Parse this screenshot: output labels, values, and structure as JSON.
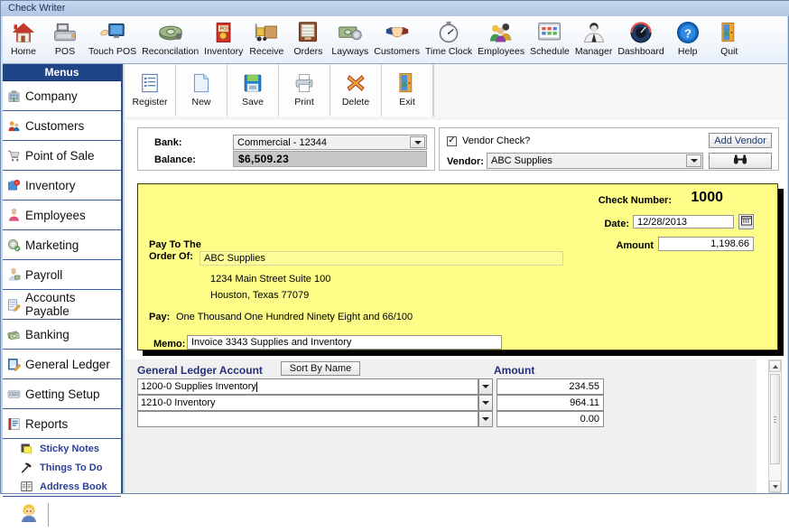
{
  "window": {
    "title": "Check Writer"
  },
  "toolbar": {
    "items": [
      {
        "label": "Home",
        "icon": "home-icon"
      },
      {
        "label": "POS",
        "icon": "cash-register-icon"
      },
      {
        "label": "Touch POS",
        "icon": "touch-screen-icon"
      },
      {
        "label": "Reconcilation",
        "icon": "money-icon"
      },
      {
        "label": "Inventory",
        "icon": "inventory-box-icon"
      },
      {
        "label": "Receive",
        "icon": "forklift-icon"
      },
      {
        "label": "Orders",
        "icon": "orders-cabinet-icon"
      },
      {
        "label": "Layways",
        "icon": "layaway-money-icon"
      },
      {
        "label": "Customers",
        "icon": "handshake-icon"
      },
      {
        "label": "Time Clock",
        "icon": "stopwatch-icon"
      },
      {
        "label": "Employees",
        "icon": "people-icon"
      },
      {
        "label": "Schedule",
        "icon": "calendar-icon"
      },
      {
        "label": "Manager",
        "icon": "manager-person-icon"
      },
      {
        "label": "Dashboard",
        "icon": "gauge-icon"
      },
      {
        "label": "Help",
        "icon": "help-question-icon"
      },
      {
        "label": "Quit",
        "icon": "exit-door-icon"
      }
    ]
  },
  "subtoolbar": {
    "items": [
      {
        "label": "Register",
        "icon": "register-list-icon"
      },
      {
        "label": "New",
        "icon": "new-page-icon"
      },
      {
        "label": "Save",
        "icon": "floppy-save-icon"
      },
      {
        "label": "Print",
        "icon": "printer-icon"
      },
      {
        "label": "Delete",
        "icon": "delete-x-icon"
      },
      {
        "label": "Exit",
        "icon": "exit-door-icon"
      }
    ]
  },
  "sidebar": {
    "header": "Menus",
    "items": [
      {
        "label": "Company",
        "icon": "company-building-icon"
      },
      {
        "label": "Customers",
        "icon": "customers-icon"
      },
      {
        "label": "Point of Sale",
        "icon": "shopping-cart-icon"
      },
      {
        "label": "Inventory",
        "icon": "inventory-icon"
      },
      {
        "label": "Employees",
        "icon": "employee-icon"
      },
      {
        "label": "Marketing",
        "icon": "marketing-icon"
      },
      {
        "label": "Payroll",
        "icon": "payroll-icon"
      },
      {
        "label": "Accounts Payable",
        "icon": "accounts-payable-icon"
      },
      {
        "label": "Banking",
        "icon": "banking-money-icon"
      },
      {
        "label": "General Ledger",
        "icon": "general-ledger-icon"
      },
      {
        "label": "Getting Setup",
        "icon": "getting-setup-icon"
      },
      {
        "label": "Reports",
        "icon": "reports-icon"
      }
    ],
    "sub_items": [
      {
        "label": "Sticky Notes",
        "icon": "sticky-note-icon"
      },
      {
        "label": "Things To Do",
        "icon": "hammer-icon"
      },
      {
        "label": "Address Book",
        "icon": "address-book-icon"
      }
    ]
  },
  "bank_panel": {
    "bank_label": "Bank:",
    "bank_value": "Commercial - 12344",
    "balance_label": "Balance:",
    "balance_value": "$6,509.23"
  },
  "vendor_panel": {
    "vendor_check_label": "Vendor Check?",
    "vendor_check_checked": true,
    "vendor_label": "Vendor:",
    "vendor_value": "ABC Supplies",
    "add_vendor_label": "Add Vendor",
    "find_icon": "binoculars-icon"
  },
  "check": {
    "check_number_label": "Check Number:",
    "check_number_value": "1000",
    "date_label": "Date:",
    "date_value": "12/28/2013",
    "calendar_icon": "calendar-picker-icon",
    "amount_label": "Amount",
    "amount_value": "1,198.66",
    "pay_to_label_line1": "Pay To The",
    "pay_to_label_line2": "Order Of:",
    "payee": "ABC Supplies",
    "address_line1": "1234 Main Street Suite 100",
    "address_line2": "Houston, Texas 77079",
    "pay_label": "Pay:",
    "pay_words": "One Thousand One Hundred Ninety Eight and 66/100",
    "memo_label": "Memo:",
    "memo_value": "Invoice 3343  Supplies and Inventory"
  },
  "ledger_grid": {
    "account_header": "General Ledger Account",
    "sort_button_label": "Sort By Name",
    "amount_header": "Amount",
    "rows": [
      {
        "account": "1200-0 Supplies Inventory",
        "amount": "234.55",
        "focused": true
      },
      {
        "account": "1210-0 Inventory",
        "amount": "964.11",
        "focused": false
      },
      {
        "account": "",
        "amount": "0.00",
        "focused": false
      }
    ]
  },
  "colors": {
    "check_yellow": "#fdfd87",
    "sidebar_header": "#1f4488",
    "link_blue": "#2b3f93",
    "heading_blue": "#24307a"
  }
}
